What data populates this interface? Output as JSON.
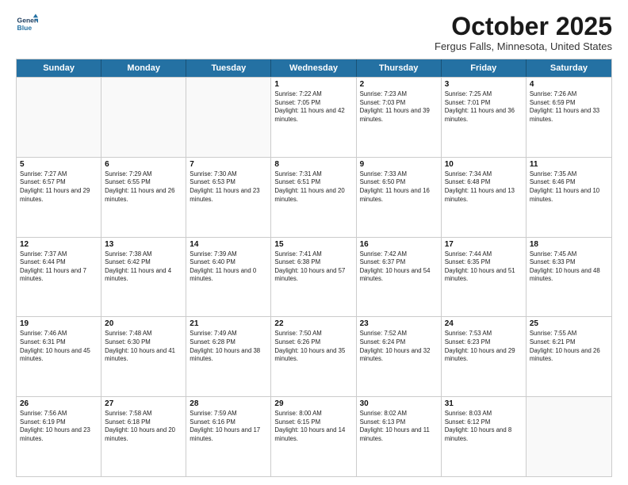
{
  "header": {
    "logo_line1": "General",
    "logo_line2": "Blue",
    "month": "October 2025",
    "location": "Fergus Falls, Minnesota, United States"
  },
  "weekdays": [
    "Sunday",
    "Monday",
    "Tuesday",
    "Wednesday",
    "Thursday",
    "Friday",
    "Saturday"
  ],
  "rows": [
    [
      {
        "day": "",
        "sunrise": "",
        "sunset": "",
        "daylight": ""
      },
      {
        "day": "",
        "sunrise": "",
        "sunset": "",
        "daylight": ""
      },
      {
        "day": "",
        "sunrise": "",
        "sunset": "",
        "daylight": ""
      },
      {
        "day": "1",
        "sunrise": "Sunrise: 7:22 AM",
        "sunset": "Sunset: 7:05 PM",
        "daylight": "Daylight: 11 hours and 42 minutes."
      },
      {
        "day": "2",
        "sunrise": "Sunrise: 7:23 AM",
        "sunset": "Sunset: 7:03 PM",
        "daylight": "Daylight: 11 hours and 39 minutes."
      },
      {
        "day": "3",
        "sunrise": "Sunrise: 7:25 AM",
        "sunset": "Sunset: 7:01 PM",
        "daylight": "Daylight: 11 hours and 36 minutes."
      },
      {
        "day": "4",
        "sunrise": "Sunrise: 7:26 AM",
        "sunset": "Sunset: 6:59 PM",
        "daylight": "Daylight: 11 hours and 33 minutes."
      }
    ],
    [
      {
        "day": "5",
        "sunrise": "Sunrise: 7:27 AM",
        "sunset": "Sunset: 6:57 PM",
        "daylight": "Daylight: 11 hours and 29 minutes."
      },
      {
        "day": "6",
        "sunrise": "Sunrise: 7:29 AM",
        "sunset": "Sunset: 6:55 PM",
        "daylight": "Daylight: 11 hours and 26 minutes."
      },
      {
        "day": "7",
        "sunrise": "Sunrise: 7:30 AM",
        "sunset": "Sunset: 6:53 PM",
        "daylight": "Daylight: 11 hours and 23 minutes."
      },
      {
        "day": "8",
        "sunrise": "Sunrise: 7:31 AM",
        "sunset": "Sunset: 6:51 PM",
        "daylight": "Daylight: 11 hours and 20 minutes."
      },
      {
        "day": "9",
        "sunrise": "Sunrise: 7:33 AM",
        "sunset": "Sunset: 6:50 PM",
        "daylight": "Daylight: 11 hours and 16 minutes."
      },
      {
        "day": "10",
        "sunrise": "Sunrise: 7:34 AM",
        "sunset": "Sunset: 6:48 PM",
        "daylight": "Daylight: 11 hours and 13 minutes."
      },
      {
        "day": "11",
        "sunrise": "Sunrise: 7:35 AM",
        "sunset": "Sunset: 6:46 PM",
        "daylight": "Daylight: 11 hours and 10 minutes."
      }
    ],
    [
      {
        "day": "12",
        "sunrise": "Sunrise: 7:37 AM",
        "sunset": "Sunset: 6:44 PM",
        "daylight": "Daylight: 11 hours and 7 minutes."
      },
      {
        "day": "13",
        "sunrise": "Sunrise: 7:38 AM",
        "sunset": "Sunset: 6:42 PM",
        "daylight": "Daylight: 11 hours and 4 minutes."
      },
      {
        "day": "14",
        "sunrise": "Sunrise: 7:39 AM",
        "sunset": "Sunset: 6:40 PM",
        "daylight": "Daylight: 11 hours and 0 minutes."
      },
      {
        "day": "15",
        "sunrise": "Sunrise: 7:41 AM",
        "sunset": "Sunset: 6:38 PM",
        "daylight": "Daylight: 10 hours and 57 minutes."
      },
      {
        "day": "16",
        "sunrise": "Sunrise: 7:42 AM",
        "sunset": "Sunset: 6:37 PM",
        "daylight": "Daylight: 10 hours and 54 minutes."
      },
      {
        "day": "17",
        "sunrise": "Sunrise: 7:44 AM",
        "sunset": "Sunset: 6:35 PM",
        "daylight": "Daylight: 10 hours and 51 minutes."
      },
      {
        "day": "18",
        "sunrise": "Sunrise: 7:45 AM",
        "sunset": "Sunset: 6:33 PM",
        "daylight": "Daylight: 10 hours and 48 minutes."
      }
    ],
    [
      {
        "day": "19",
        "sunrise": "Sunrise: 7:46 AM",
        "sunset": "Sunset: 6:31 PM",
        "daylight": "Daylight: 10 hours and 45 minutes."
      },
      {
        "day": "20",
        "sunrise": "Sunrise: 7:48 AM",
        "sunset": "Sunset: 6:30 PM",
        "daylight": "Daylight: 10 hours and 41 minutes."
      },
      {
        "day": "21",
        "sunrise": "Sunrise: 7:49 AM",
        "sunset": "Sunset: 6:28 PM",
        "daylight": "Daylight: 10 hours and 38 minutes."
      },
      {
        "day": "22",
        "sunrise": "Sunrise: 7:50 AM",
        "sunset": "Sunset: 6:26 PM",
        "daylight": "Daylight: 10 hours and 35 minutes."
      },
      {
        "day": "23",
        "sunrise": "Sunrise: 7:52 AM",
        "sunset": "Sunset: 6:24 PM",
        "daylight": "Daylight: 10 hours and 32 minutes."
      },
      {
        "day": "24",
        "sunrise": "Sunrise: 7:53 AM",
        "sunset": "Sunset: 6:23 PM",
        "daylight": "Daylight: 10 hours and 29 minutes."
      },
      {
        "day": "25",
        "sunrise": "Sunrise: 7:55 AM",
        "sunset": "Sunset: 6:21 PM",
        "daylight": "Daylight: 10 hours and 26 minutes."
      }
    ],
    [
      {
        "day": "26",
        "sunrise": "Sunrise: 7:56 AM",
        "sunset": "Sunset: 6:19 PM",
        "daylight": "Daylight: 10 hours and 23 minutes."
      },
      {
        "day": "27",
        "sunrise": "Sunrise: 7:58 AM",
        "sunset": "Sunset: 6:18 PM",
        "daylight": "Daylight: 10 hours and 20 minutes."
      },
      {
        "day": "28",
        "sunrise": "Sunrise: 7:59 AM",
        "sunset": "Sunset: 6:16 PM",
        "daylight": "Daylight: 10 hours and 17 minutes."
      },
      {
        "day": "29",
        "sunrise": "Sunrise: 8:00 AM",
        "sunset": "Sunset: 6:15 PM",
        "daylight": "Daylight: 10 hours and 14 minutes."
      },
      {
        "day": "30",
        "sunrise": "Sunrise: 8:02 AM",
        "sunset": "Sunset: 6:13 PM",
        "daylight": "Daylight: 10 hours and 11 minutes."
      },
      {
        "day": "31",
        "sunrise": "Sunrise: 8:03 AM",
        "sunset": "Sunset: 6:12 PM",
        "daylight": "Daylight: 10 hours and 8 minutes."
      },
      {
        "day": "",
        "sunrise": "",
        "sunset": "",
        "daylight": ""
      }
    ]
  ]
}
